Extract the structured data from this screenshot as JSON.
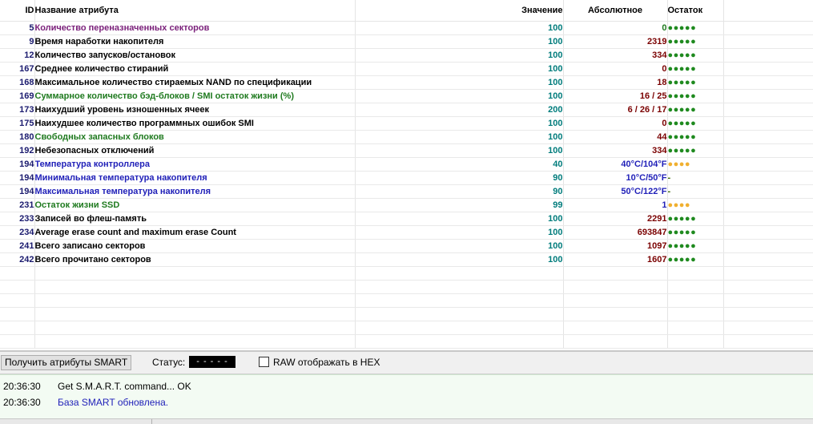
{
  "columns": {
    "id": "ID",
    "name": "Название атрибута",
    "value": "Значение",
    "absolute": "Абсолютное",
    "remaining": "Остаток"
  },
  "colors": {
    "purple": "#7a1f7a",
    "black": "#000000",
    "green": "#1f7a1f",
    "blue": "#1f1fb8",
    "value": "#007c7c",
    "abs_default": "#7a0000",
    "dots_green": "#1f8a1f",
    "dots_orange": "#f0b030",
    "id": "#1a1a6e"
  },
  "rows": [
    {
      "id": "5",
      "name": "Количество переназначенных секторов",
      "value": "100",
      "absolute": "0",
      "remaining": "●●●●●",
      "name_color": "purple",
      "abs_color": "green",
      "dots_color": "dots_green"
    },
    {
      "id": "9",
      "name": "Время наработки накопителя",
      "value": "100",
      "absolute": "2319",
      "remaining": "●●●●●",
      "name_color": "black",
      "abs_color": "abs_default",
      "dots_color": "dots_green"
    },
    {
      "id": "12",
      "name": "Количество запусков/остановок",
      "value": "100",
      "absolute": "334",
      "remaining": "●●●●●",
      "name_color": "black",
      "abs_color": "abs_default",
      "dots_color": "dots_green"
    },
    {
      "id": "167",
      "name": "Среднее количество стираний",
      "value": "100",
      "absolute": "0",
      "remaining": "●●●●●",
      "name_color": "black",
      "abs_color": "abs_default",
      "dots_color": "dots_green"
    },
    {
      "id": "168",
      "name": "Максимальное количество стираемых NAND по спецификации",
      "value": "100",
      "absolute": "18",
      "remaining": "●●●●●",
      "name_color": "black",
      "abs_color": "abs_default",
      "dots_color": "dots_green"
    },
    {
      "id": "169",
      "name": "Суммарное количество бэд-блоков / SMI остаток жизни (%)",
      "value": "100",
      "absolute": "16 / 25",
      "remaining": "●●●●●",
      "name_color": "green",
      "abs_color": "abs_default",
      "dots_color": "dots_green"
    },
    {
      "id": "173",
      "name": "Наихудший уровень изношенных ячеек",
      "value": "200",
      "absolute": "6 / 26 / 17",
      "remaining": "●●●●●",
      "name_color": "black",
      "abs_color": "abs_default",
      "dots_color": "dots_green"
    },
    {
      "id": "175",
      "name": "Наихудшее количество программных ошибок SMI",
      "value": "100",
      "absolute": "0",
      "remaining": "●●●●●",
      "name_color": "black",
      "abs_color": "abs_default",
      "dots_color": "dots_green"
    },
    {
      "id": "180",
      "name": "Свободных запасных блоков",
      "value": "100",
      "absolute": "44",
      "remaining": "●●●●●",
      "name_color": "green",
      "abs_color": "abs_default",
      "dots_color": "dots_green"
    },
    {
      "id": "192",
      "name": "Небезопасных отключений",
      "value": "100",
      "absolute": "334",
      "remaining": "●●●●●",
      "name_color": "black",
      "abs_color": "abs_default",
      "dots_color": "dots_green"
    },
    {
      "id": "194",
      "name": "Температура контроллера",
      "value": "40",
      "absolute": "40°C/104°F",
      "remaining": "●●●●",
      "name_color": "blue",
      "abs_color": "blue",
      "dots_color": "dots_orange"
    },
    {
      "id": "194",
      "name": "Минимальная температура накопителя",
      "value": "90",
      "absolute": "10°C/50°F",
      "remaining": "-",
      "name_color": "blue",
      "abs_color": "blue",
      "dots_color": "dots_orange"
    },
    {
      "id": "194",
      "name": "Максимальная температура накопителя",
      "value": "90",
      "absolute": "50°C/122°F",
      "remaining": "-",
      "name_color": "blue",
      "abs_color": "blue",
      "dots_color": "dots_orange"
    },
    {
      "id": "231",
      "name": "Остаток жизни SSD",
      "value": "99",
      "absolute": "1",
      "remaining": "●●●●",
      "name_color": "green",
      "abs_color": "blue",
      "dots_color": "dots_orange"
    },
    {
      "id": "233",
      "name": "Записей во флеш-память",
      "value": "100",
      "absolute": "2291",
      "remaining": "●●●●●",
      "name_color": "black",
      "abs_color": "abs_default",
      "dots_color": "dots_green"
    },
    {
      "id": "234",
      "name": "Average erase count and maximum erase Count",
      "value": "100",
      "absolute": "693847",
      "remaining": "●●●●●",
      "name_color": "black",
      "abs_color": "abs_default",
      "dots_color": "dots_green"
    },
    {
      "id": "241",
      "name": "Всего записано секторов",
      "value": "100",
      "absolute": "1097",
      "remaining": "●●●●●",
      "name_color": "black",
      "abs_color": "abs_default",
      "dots_color": "dots_green"
    },
    {
      "id": "242",
      "name": "Всего прочитано секторов",
      "value": "100",
      "absolute": "1607",
      "remaining": "●●●●●",
      "name_color": "black",
      "abs_color": "abs_default",
      "dots_color": "dots_green"
    }
  ],
  "toolbar": {
    "get_smart_label": "Получить атрибуты SMART",
    "status_label": "Статус:",
    "status_value": "- - - - -",
    "hex_label": "RAW отображать в HEX",
    "hex_checked": false
  },
  "log": [
    {
      "time": "20:36:30",
      "message": "Get S.M.A.R.T. command... OK",
      "color": "#000000"
    },
    {
      "time": "20:36:30",
      "message": "База SMART обновлена.",
      "color": "#1f1fb8"
    }
  ]
}
